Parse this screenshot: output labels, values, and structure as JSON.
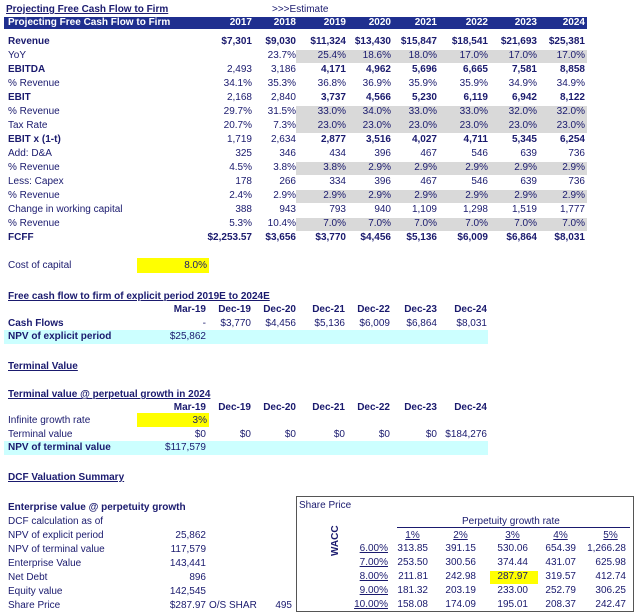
{
  "title": "Projecting Free Cash Flow to Firm",
  "estimate_label": ">>>Estimate",
  "header": {
    "label": "Projecting Free Cash Flow to Firm",
    "years": [
      "2017",
      "2018",
      "2019",
      "2020",
      "2021",
      "2022",
      "2023",
      "2024"
    ]
  },
  "rows": [
    {
      "label": "Revenue",
      "bold": true,
      "values": [
        "$7,301",
        "$9,030",
        "$11,324",
        "$13,430",
        "$15,847",
        "$18,541",
        "$21,693",
        "$25,381"
      ]
    },
    {
      "label": "YoY",
      "values": [
        "",
        "23.7%",
        "25.4%",
        "18.6%",
        "18.0%",
        "17.0%",
        "17.0%",
        "17.0%"
      ]
    },
    {
      "label": "EBITDA",
      "bold": true,
      "values": [
        "2,493",
        "3,186",
        "4,171",
        "4,962",
        "5,696",
        "6,665",
        "7,581",
        "8,858"
      ]
    },
    {
      "label": "% Revenue",
      "values": [
        "34.1%",
        "35.3%",
        "36.8%",
        "36.9%",
        "35.9%",
        "35.9%",
        "34.9%",
        "34.9%"
      ]
    },
    {
      "label": "EBIT",
      "bold": true,
      "values": [
        "2,168",
        "2,840",
        "3,737",
        "4,566",
        "5,230",
        "6,119",
        "6,942",
        "8,122"
      ]
    },
    {
      "label": "% Revenue",
      "values": [
        "29.7%",
        "31.5%",
        "33.0%",
        "34.0%",
        "33.0%",
        "33.0%",
        "32.0%",
        "32.0%"
      ]
    },
    {
      "label": "Tax Rate",
      "values": [
        "20.7%",
        "7.3%",
        "23.0%",
        "23.0%",
        "23.0%",
        "23.0%",
        "23.0%",
        "23.0%"
      ]
    },
    {
      "label": "EBIT x (1-t)",
      "bold": true,
      "values": [
        "1,719",
        "2,634",
        "2,877",
        "3,516",
        "4,027",
        "4,711",
        "5,345",
        "6,254"
      ]
    },
    {
      "label": "Add: D&A",
      "values": [
        "325",
        "346",
        "434",
        "396",
        "467",
        "546",
        "639",
        "736"
      ]
    },
    {
      "label": "% Revenue",
      "values": [
        "4.5%",
        "3.8%",
        "3.8%",
        "2.9%",
        "2.9%",
        "2.9%",
        "2.9%",
        "2.9%"
      ]
    },
    {
      "label": "Less: Capex",
      "values": [
        "178",
        "266",
        "334",
        "396",
        "467",
        "546",
        "639",
        "736"
      ]
    },
    {
      "label": "% Revenue",
      "values": [
        "2.4%",
        "2.9%",
        "2.9%",
        "2.9%",
        "2.9%",
        "2.9%",
        "2.9%",
        "2.9%"
      ]
    },
    {
      "label": "Change in working capital",
      "values": [
        "388",
        "943",
        "793",
        "940",
        "1,109",
        "1,298",
        "1,519",
        "1,777"
      ]
    },
    {
      "label": "% Revenue",
      "values": [
        "5.3%",
        "10.4%",
        "7.0%",
        "7.0%",
        "7.0%",
        "7.0%",
        "7.0%",
        "7.0%"
      ]
    },
    {
      "label": "FCFF",
      "bold": true,
      "values": [
        "$2,253.57",
        "$3,656",
        "$3,770",
        "$4,456",
        "$5,136",
        "$6,009",
        "$6,864",
        "$8,031"
      ]
    }
  ],
  "cost_of_capital": {
    "label": "Cost of capital",
    "value": "8.0%"
  },
  "explicit": {
    "title": "Free cash flow to firm of explicit period 2019E to 2024E",
    "dates": [
      "Mar-19",
      "Dec-19",
      "Dec-20",
      "Dec-21",
      "Dec-22",
      "Dec-23",
      "Dec-24"
    ],
    "cash_flows_label": "Cash Flows",
    "cash_flows": [
      "-",
      "$3,770",
      "$4,456",
      "$5,136",
      "$6,009",
      "$6,864",
      "$8,031"
    ],
    "npv_label": "NPV of explicit period",
    "npv": "$25,862"
  },
  "terminal_value_title": "Terminal Value",
  "terminal": {
    "title": "Terminal value @ perpetual growth in 2024",
    "dates": [
      "Mar-19",
      "Dec-19",
      "Dec-20",
      "Dec-21",
      "Dec-22",
      "Dec-23",
      "Dec-24"
    ],
    "growth_label": "Infinite growth rate",
    "growth": "3%",
    "tv_label": "Terminal value",
    "tv": [
      "$0",
      "$0",
      "$0",
      "$0",
      "$0",
      "$0",
      "$184,276"
    ],
    "npv_label": "NPV of terminal value",
    "npv": "$117,579"
  },
  "dcf_title": "DCF Valuation Summary",
  "ev": {
    "title": "Enterprise value @ perpetuity growth",
    "calc_label": "DCF calculation as of",
    "items": [
      {
        "label": "NPV of explicit period",
        "value": "25,862"
      },
      {
        "label": "NPV of terminal value",
        "value": "117,579"
      },
      {
        "label": "Enterprise Value",
        "value": "143,441"
      },
      {
        "label": "Net Debt",
        "value": "896"
      },
      {
        "label": "Equity value",
        "value": "142,545"
      }
    ],
    "share_price_label": "Share Price",
    "share_price": "$287.97",
    "os_label": "O/S SHAR",
    "os_value": "495"
  },
  "sensitivity": {
    "box_title": "Share Price",
    "growth_title": "Perpetuity growth rate",
    "growth_rates": [
      "1%",
      "2%",
      "3%",
      "4%",
      "5%"
    ],
    "wacc_label": "WACC",
    "rows": [
      {
        "wacc": "6.00%",
        "values": [
          "313.85",
          "391.15",
          "530.06",
          "654.39",
          "1,266.28"
        ]
      },
      {
        "wacc": "7.00%",
        "values": [
          "253.50",
          "300.56",
          "374.44",
          "431.07",
          "625.98"
        ]
      },
      {
        "wacc": "8.00%",
        "values": [
          "211.81",
          "242.98",
          "287.97",
          "319.57",
          "412.74"
        ]
      },
      {
        "wacc": "9.00%",
        "values": [
          "181.32",
          "203.19",
          "233.00",
          "252.79",
          "306.25"
        ]
      },
      {
        "wacc": "10.00%",
        "values": [
          "158.08",
          "174.09",
          "195.01",
          "208.37",
          "242.47"
        ]
      }
    ]
  },
  "colors": {
    "header_band": "#1f2f8f",
    "input_fill": "#d9d9d9",
    "highlight": "#ffff00",
    "npv_fill": "#ccffff",
    "text": "#1a1a6e"
  }
}
